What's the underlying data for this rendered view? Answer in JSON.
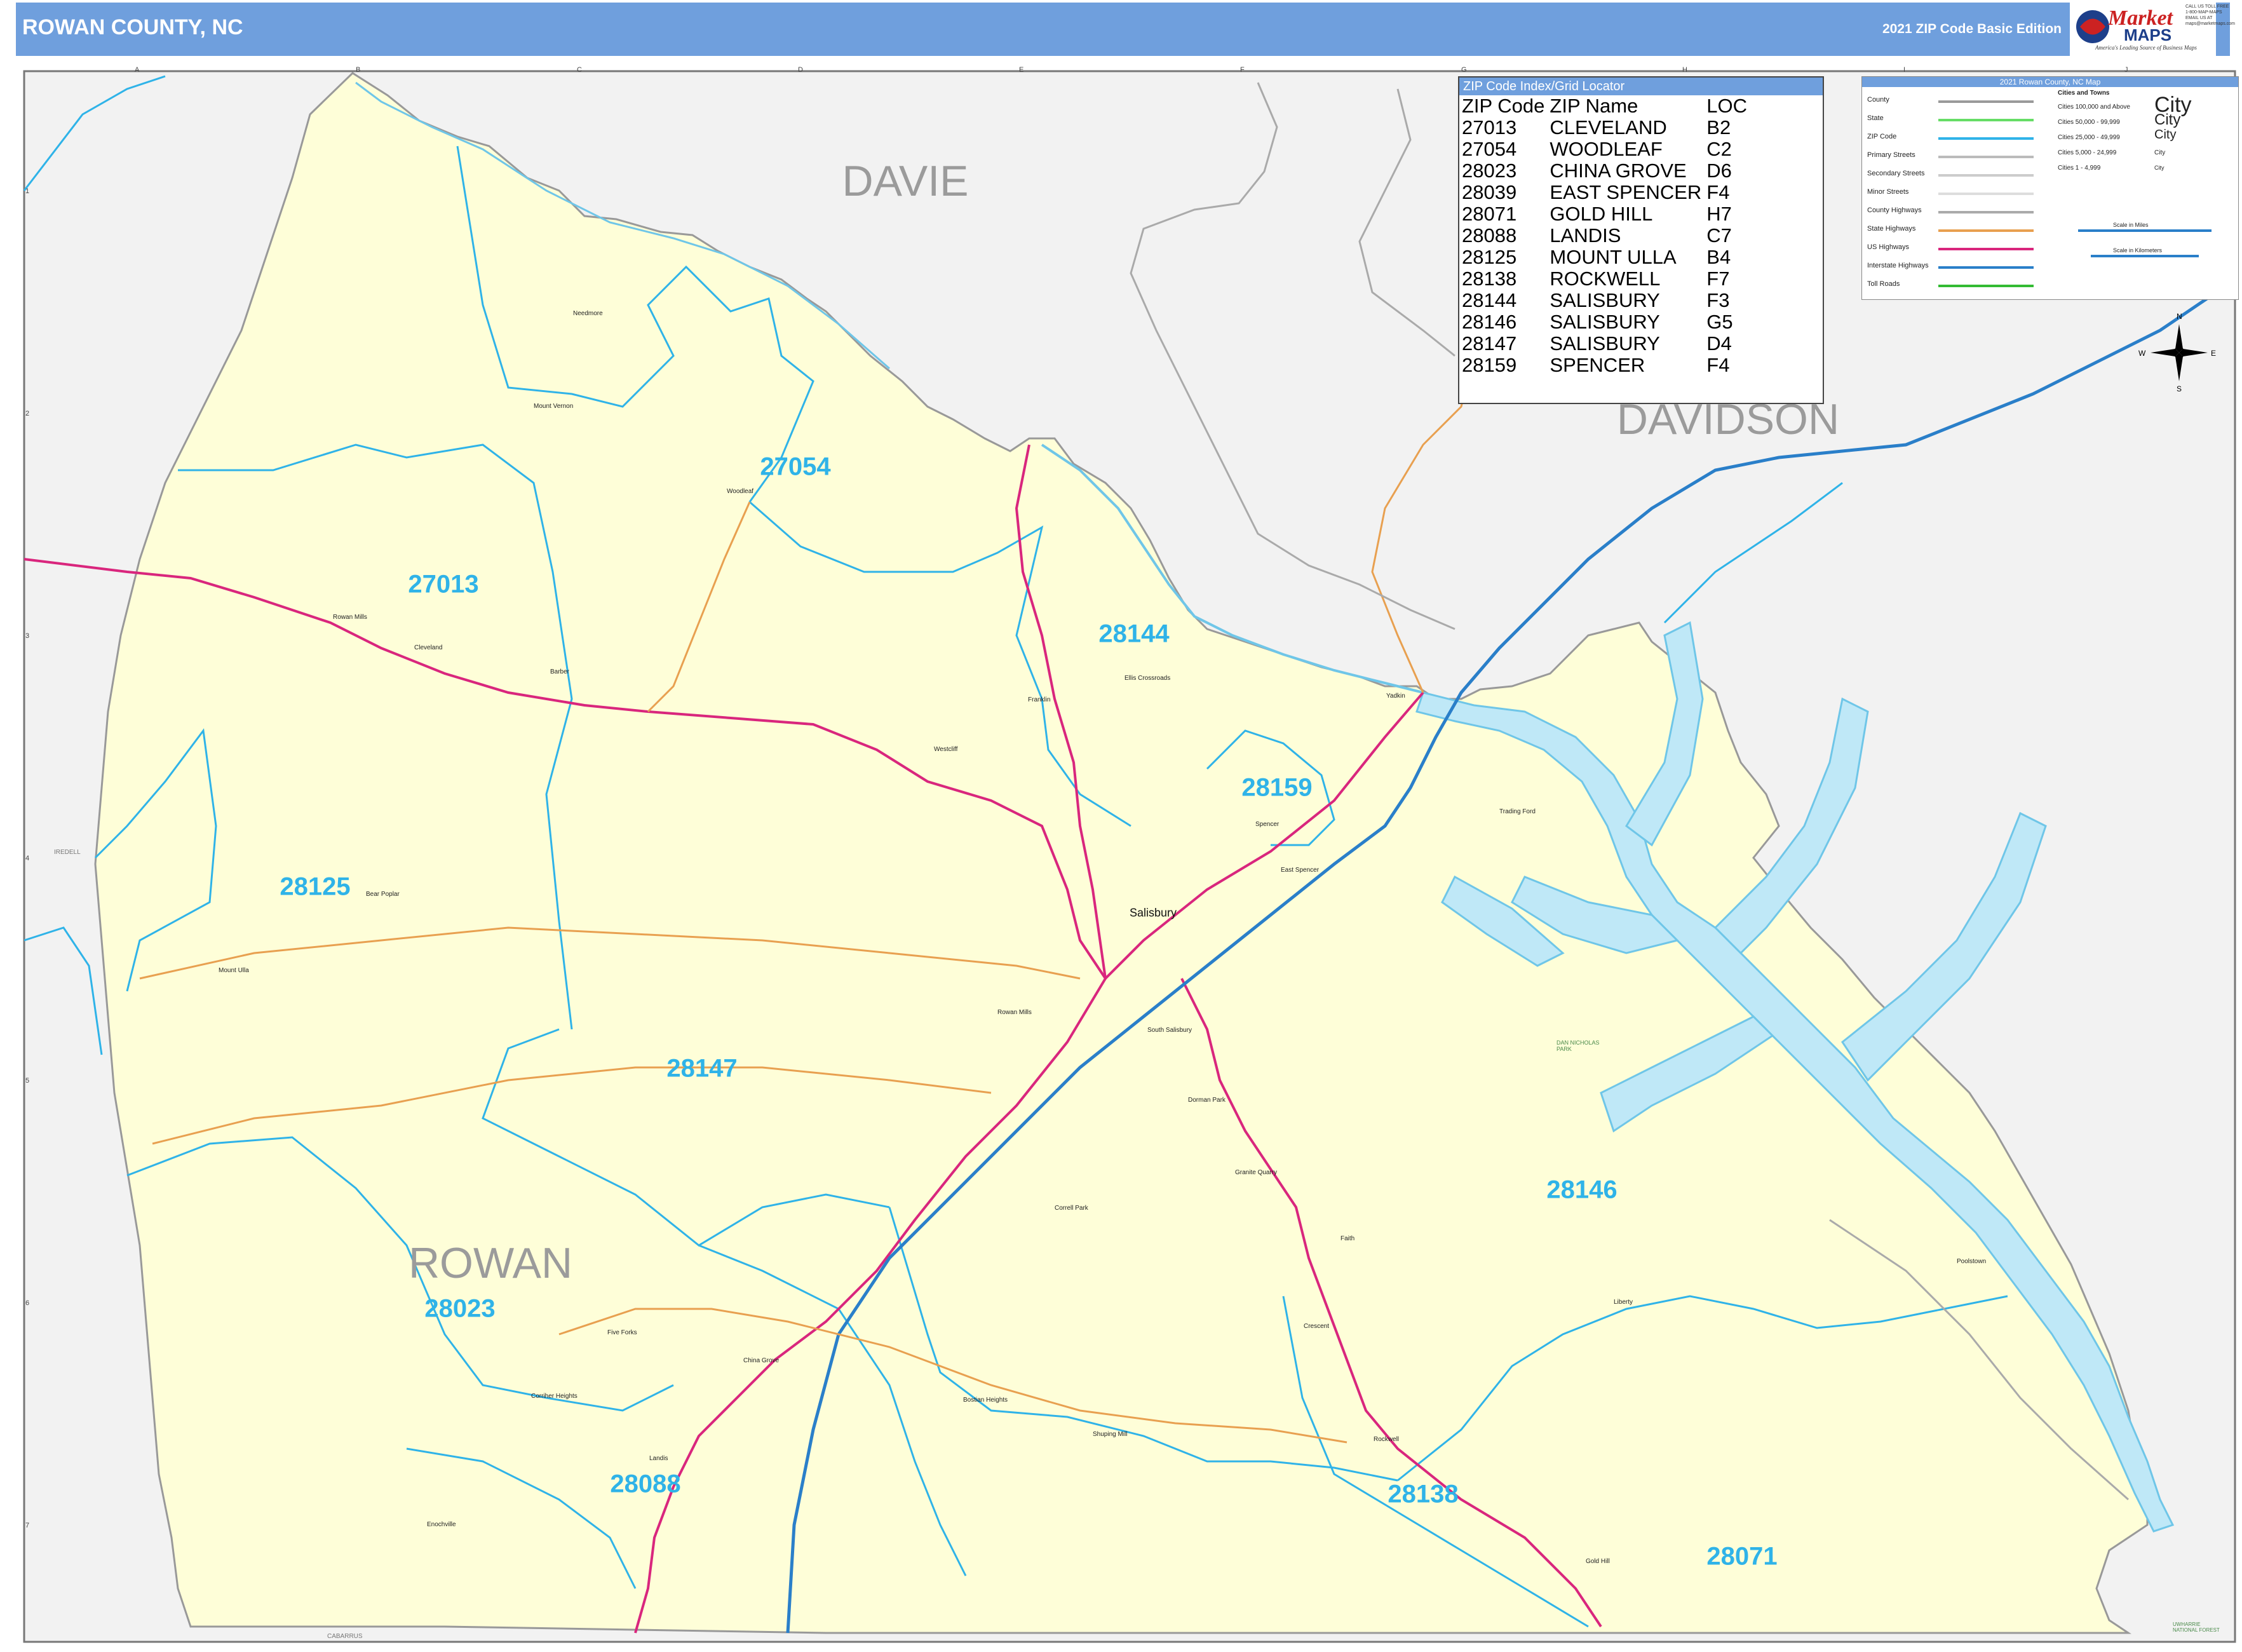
{
  "header": {
    "title": "ROWAN COUNTY, NC",
    "edition": "2021 ZIP Code Basic Edition"
  },
  "logo": {
    "brand_a": "Market",
    "brand_b": "MAPS",
    "tagline": "America's Leading Source of Business Maps",
    "contact": [
      "CALL US TOLL FREE",
      "1-800-MAP-MAPS",
      "EMAIL US AT",
      "maps@marketmaps.com"
    ]
  },
  "index": {
    "title": "ZIP Code Index/Grid Locator",
    "columns": [
      "ZIP Code",
      "ZIP Name",
      "LOC"
    ],
    "rows": [
      [
        "27013",
        "CLEVELAND",
        "B2"
      ],
      [
        "27054",
        "WOODLEAF",
        "C2"
      ],
      [
        "28023",
        "CHINA GROVE",
        "D6"
      ],
      [
        "28039",
        "EAST SPENCER",
        "F4"
      ],
      [
        "28071",
        "GOLD HILL",
        "H7"
      ],
      [
        "28088",
        "LANDIS",
        "C7"
      ],
      [
        "28125",
        "MOUNT ULLA",
        "B4"
      ],
      [
        "28138",
        "ROCKWELL",
        "F7"
      ],
      [
        "28144",
        "SALISBURY",
        "F3"
      ],
      [
        "28146",
        "SALISBURY",
        "G5"
      ],
      [
        "28147",
        "SALISBURY",
        "D4"
      ],
      [
        "28159",
        "SPENCER",
        "F4"
      ]
    ]
  },
  "legend": {
    "title": "2021 Rowan County, NC Map",
    "items": [
      {
        "label": "County",
        "color": "#9a9a9a"
      },
      {
        "label": "State",
        "color": "#66dd66"
      },
      {
        "label": "ZIP Code",
        "color": "#2fb3e8"
      },
      {
        "label": "Primary Streets",
        "color": "#bbbbbb"
      },
      {
        "label": "Secondary Streets",
        "color": "#cccccc"
      },
      {
        "label": "Minor Streets",
        "color": "#dddddd"
      },
      {
        "label": "County Highways",
        "color": "#aaaaaa"
      },
      {
        "label": "State Highways",
        "color": "#e8a050"
      },
      {
        "label": "US Highways",
        "color": "#d9267d"
      },
      {
        "label": "Interstate Highways",
        "color": "#2a7fc9"
      },
      {
        "label": "Toll Roads",
        "color": "#33bb33"
      }
    ],
    "cities_title": "Cities and Towns",
    "cities": [
      {
        "label": "Cities 100,000 and Above",
        "sample": "City"
      },
      {
        "label": "Cities 50,000 - 99,999",
        "sample": "City"
      },
      {
        "label": "Cities 25,000 - 49,999",
        "sample": "City"
      },
      {
        "label": "Cities 5,000 - 24,999",
        "sample": "City"
      },
      {
        "label": "Cities 1 - 4,999",
        "sample": "City"
      }
    ],
    "scale_miles": "Scale in Miles",
    "scale_km": "Scale in Kilometers"
  },
  "compass": {
    "n": "N",
    "s": "S",
    "e": "E",
    "w": "W"
  },
  "grid": {
    "columns": [
      "A",
      "B",
      "C",
      "D",
      "E",
      "F",
      "G",
      "H",
      "I",
      "J"
    ],
    "rows": [
      "1",
      "2",
      "3",
      "4",
      "5",
      "6",
      "7"
    ]
  },
  "map": {
    "counties": [
      "DAVIE",
      "DAVIDSON",
      "ROWAN"
    ],
    "edge_counties": [
      "IREDELL",
      "CABARRUS"
    ],
    "zip_labels": [
      "27054",
      "27013",
      "28144",
      "28159",
      "28125",
      "28147",
      "28146",
      "28023",
      "28088",
      "28138",
      "28071"
    ],
    "city": "Salisbury",
    "towns": [
      "Needmore",
      "Mount Vernon",
      "Woodleaf",
      "Rowan Mills",
      "Cleveland",
      "Barber",
      "Ellis Crossroads",
      "Franklin",
      "Westcliff",
      "Spencer",
      "East Spencer",
      "Trading Ford",
      "Bear Poplar",
      "Mount Ulla",
      "Rowan Mills",
      "South Salisbury",
      "Dorman Park",
      "Granite Quarry",
      "Correll Park",
      "Faith",
      "Liberty",
      "Poolstown",
      "Five Forks",
      "China Grove",
      "Corriher Heights",
      "Landis",
      "Enochville",
      "Bostian Heights",
      "Shuping Mill",
      "Crescent",
      "Rockwell",
      "Gold Hill",
      "Yadkin"
    ],
    "parks": [
      "DAN NICHOLAS PARK",
      "UWHARRIE NATIONAL FOREST"
    ]
  }
}
